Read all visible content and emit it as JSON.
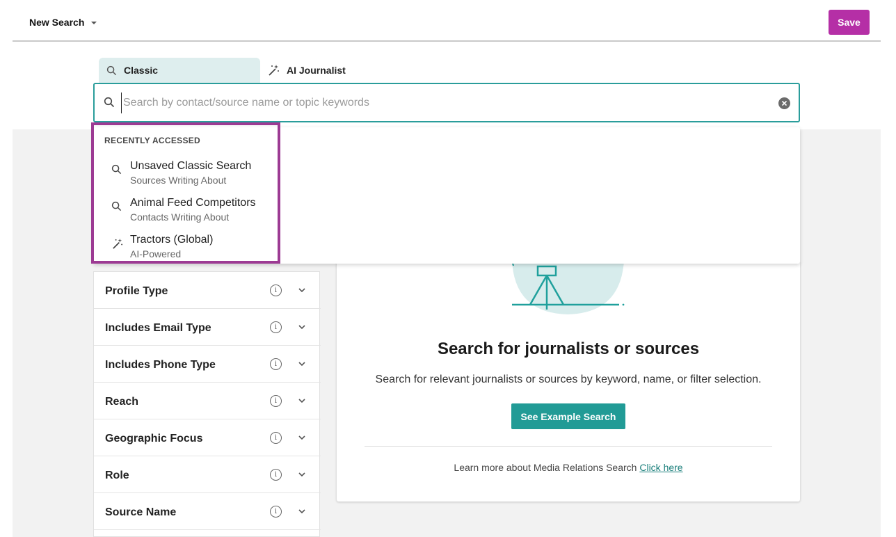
{
  "header": {
    "title": "New Search",
    "save_label": "Save"
  },
  "tabs": [
    {
      "label": "Classic",
      "icon": "search-icon"
    },
    {
      "label": "AI Journalist",
      "icon": "magic-wand-icon"
    }
  ],
  "search": {
    "placeholder": "Search by contact/source name or topic keywords",
    "value": ""
  },
  "recent": {
    "title": "RECENTLY ACCESSED",
    "items": [
      {
        "title": "Unsaved Classic Search",
        "subtitle": "Sources Writing About",
        "icon": "search-icon"
      },
      {
        "title": "Animal Feed Competitors",
        "subtitle": "Contacts Writing About",
        "icon": "search-icon"
      },
      {
        "title": "Tractors (Global)",
        "subtitle": "AI-Powered",
        "icon": "magic-wand-icon"
      }
    ]
  },
  "filters": [
    {
      "label": "Profile Type"
    },
    {
      "label": "Includes Email Type"
    },
    {
      "label": "Includes Phone Type"
    },
    {
      "label": "Reach"
    },
    {
      "label": "Geographic Focus"
    },
    {
      "label": "Role"
    },
    {
      "label": "Source Name"
    }
  ],
  "empty_state": {
    "title": "Search for journalists or sources",
    "description": "Search for relevant journalists or sources by keyword, name, or filter selection.",
    "button_label": "See Example Search",
    "learn_text": "Learn more about Media Relations Search",
    "learn_link": "Click here"
  },
  "colors": {
    "save": "#b52fa6",
    "teal": "#2a9d9b",
    "highlight": "#9c3a93",
    "tab_active": "#deeeee"
  }
}
